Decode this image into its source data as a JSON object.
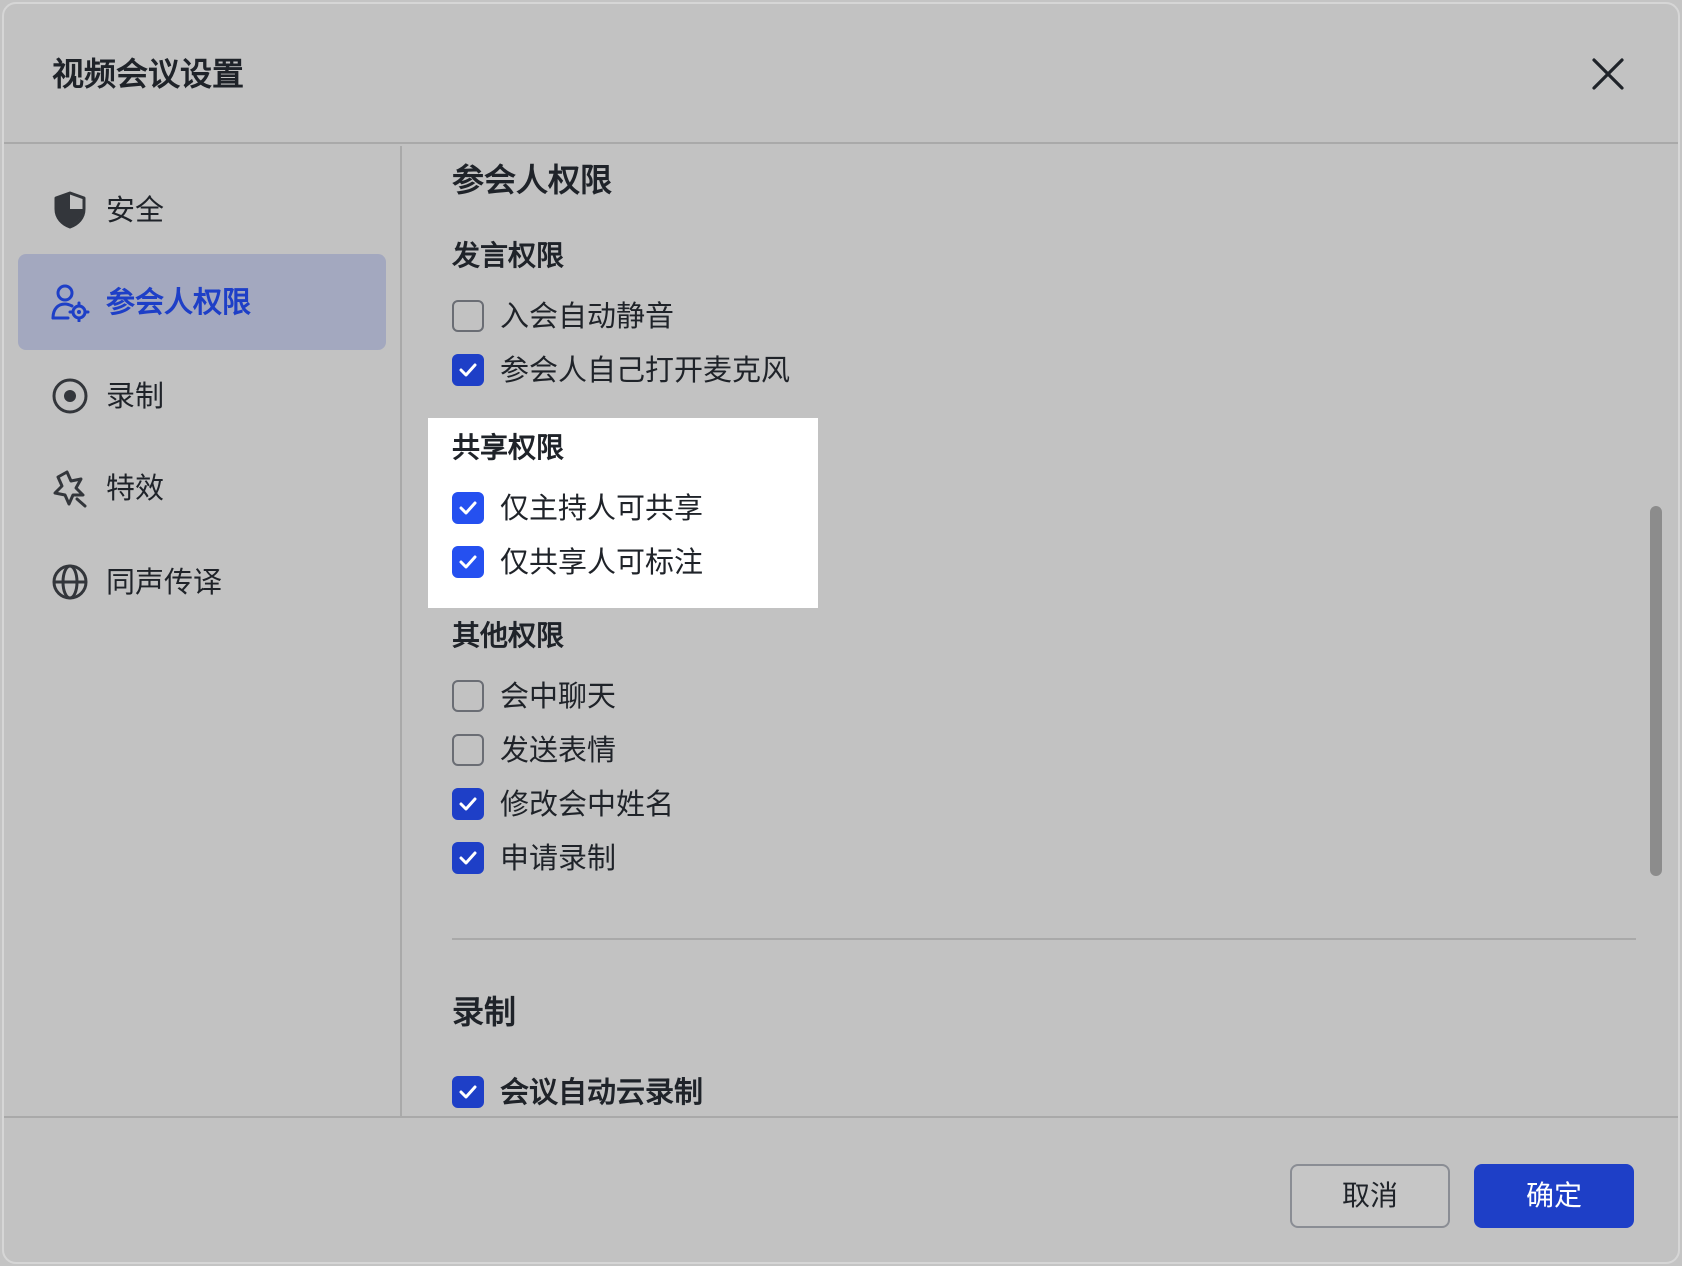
{
  "dialog": {
    "title": "视频会议设置"
  },
  "sidebar": {
    "items": [
      {
        "label": "安全",
        "icon": "shield-icon",
        "active": false
      },
      {
        "label": "参会人权限",
        "icon": "user-settings-icon",
        "active": true
      },
      {
        "label": "录制",
        "icon": "record-icon",
        "active": false
      },
      {
        "label": "特效",
        "icon": "sparkle-icon",
        "active": false
      },
      {
        "label": "同声传译",
        "icon": "globe-icon",
        "active": false
      }
    ]
  },
  "content": {
    "participant_permissions": {
      "title": "参会人权限",
      "speak": {
        "title": "发言权限",
        "options": [
          {
            "label": "入会自动静音",
            "checked": false
          },
          {
            "label": "参会人自己打开麦克风",
            "checked": true
          }
        ]
      },
      "share": {
        "title": "共享权限",
        "options": [
          {
            "label": "仅主持人可共享",
            "checked": true
          },
          {
            "label": "仅共享人可标注",
            "checked": true
          }
        ]
      },
      "other": {
        "title": "其他权限",
        "options": [
          {
            "label": "会中聊天",
            "checked": false
          },
          {
            "label": "发送表情",
            "checked": false
          },
          {
            "label": "修改会中姓名",
            "checked": true
          },
          {
            "label": "申请录制",
            "checked": true
          }
        ]
      }
    },
    "recording": {
      "title": "录制",
      "options": [
        {
          "label": "会议自动云录制",
          "checked": true
        }
      ]
    }
  },
  "footer": {
    "cancel_label": "取消",
    "confirm_label": "确定"
  },
  "colors": {
    "accent": "#1e3fc7",
    "highlight_accent": "#2550f0",
    "active_nav_bg": "#a3a8bf"
  }
}
